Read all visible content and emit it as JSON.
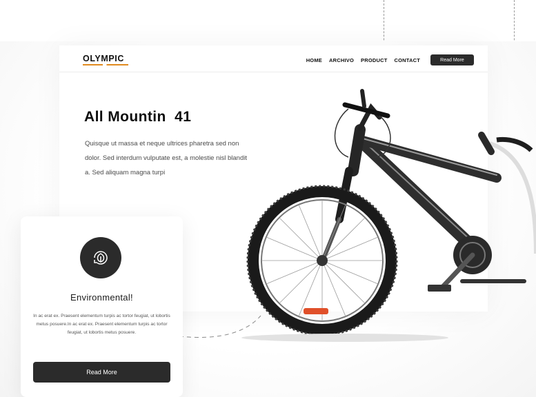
{
  "brand": {
    "logo": "OLYMPIC",
    "accent_color": "#e08a1e"
  },
  "nav": {
    "items": [
      "HOME",
      "ARCHIVO",
      "PRODUCT",
      "CONTACT"
    ],
    "cta_label": "Read More"
  },
  "hero": {
    "title": "All Mountin  41",
    "description": "Quisque ut massa et neque ultrices pharetra sed non dolor. Sed interdum vulputate est, a molestie nisl blandit a. Sed aliquam magna turpi",
    "image_icon": "mountain-bike"
  },
  "card": {
    "icon": "eco-leaf-icon",
    "title": "Environmental!",
    "text": "In ac erat ex. Praesent elementum turpis ac tortor feugiat, ut lobortis metus posuere.In ac erat ex. Praesent elementum turpis ac tortor feugiat, ut lobortis metus posuere.",
    "button_label": "Read More"
  },
  "colors": {
    "dark": "#2b2b2b",
    "background": "#ffffff"
  }
}
